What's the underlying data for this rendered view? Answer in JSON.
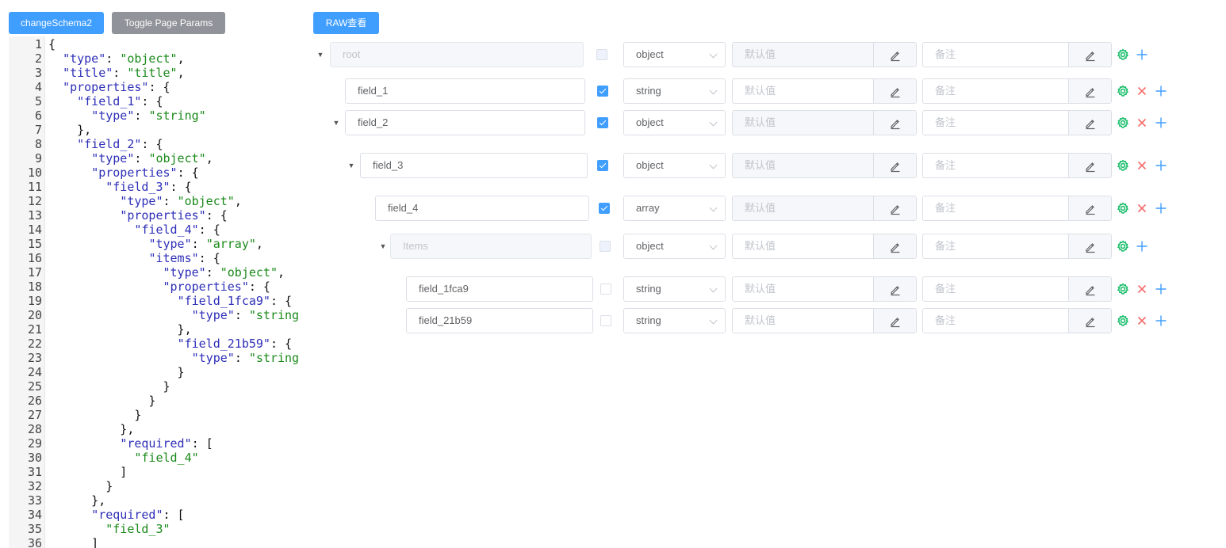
{
  "toolbar": {
    "change_schema_label": "changeSchema2",
    "toggle_params_label": "Toggle Page Params",
    "raw_view_label": "RAW查看"
  },
  "editor": {
    "lines": [
      {
        "n": "1",
        "t": "{"
      },
      {
        "n": "2",
        "t": "  \"type\": \"object\","
      },
      {
        "n": "3",
        "t": "  \"title\": \"title\","
      },
      {
        "n": "4",
        "t": "  \"properties\": {"
      },
      {
        "n": "5",
        "t": "    \"field_1\": {"
      },
      {
        "n": "6",
        "t": "      \"type\": \"string\""
      },
      {
        "n": "7",
        "t": "    },"
      },
      {
        "n": "8",
        "t": "    \"field_2\": {"
      },
      {
        "n": "9",
        "t": "      \"type\": \"object\","
      },
      {
        "n": "10",
        "t": "      \"properties\": {"
      },
      {
        "n": "11",
        "t": "        \"field_3\": {"
      },
      {
        "n": "12",
        "t": "          \"type\": \"object\","
      },
      {
        "n": "13",
        "t": "          \"properties\": {"
      },
      {
        "n": "14",
        "t": "            \"field_4\": {"
      },
      {
        "n": "15",
        "t": "              \"type\": \"array\","
      },
      {
        "n": "16",
        "t": "              \"items\": {"
      },
      {
        "n": "17",
        "t": "                \"type\": \"object\","
      },
      {
        "n": "18",
        "t": "                \"properties\": {"
      },
      {
        "n": "19",
        "t": "                  \"field_1fca9\": {"
      },
      {
        "n": "20",
        "t": "                    \"type\": \"string"
      },
      {
        "n": "21",
        "t": "                  },"
      },
      {
        "n": "22",
        "t": "                  \"field_21b59\": {"
      },
      {
        "n": "23",
        "t": "                    \"type\": \"string"
      },
      {
        "n": "24",
        "t": "                  }"
      },
      {
        "n": "25",
        "t": "                }"
      },
      {
        "n": "26",
        "t": "              }"
      },
      {
        "n": "27",
        "t": "            }"
      },
      {
        "n": "28",
        "t": "          },"
      },
      {
        "n": "29",
        "t": "          \"required\": ["
      },
      {
        "n": "30",
        "t": "            \"field_4\""
      },
      {
        "n": "31",
        "t": "          ]"
      },
      {
        "n": "32",
        "t": "        }"
      },
      {
        "n": "33",
        "t": "      },"
      },
      {
        "n": "34",
        "t": "      \"required\": ["
      },
      {
        "n": "35",
        "t": "        \"field_3\""
      },
      {
        "n": "36",
        "t": "      ]"
      }
    ]
  },
  "schema": {
    "default_placeholder": "默认值",
    "note_placeholder": "备注",
    "rows": [
      {
        "name": "root",
        "type": "object",
        "required": false,
        "expandable": true,
        "disabled": true,
        "removable": false,
        "default_disabled": true
      },
      {
        "name": "field_1",
        "type": "string",
        "required": true,
        "expandable": false,
        "disabled": false,
        "removable": true,
        "default_disabled": false
      },
      {
        "name": "field_2",
        "type": "object",
        "required": true,
        "expandable": true,
        "disabled": false,
        "removable": true,
        "default_disabled": true
      },
      {
        "name": "field_3",
        "type": "object",
        "required": true,
        "expandable": true,
        "disabled": false,
        "removable": true,
        "default_disabled": true
      },
      {
        "name": "field_4",
        "type": "array",
        "required": true,
        "expandable": false,
        "disabled": false,
        "removable": true,
        "default_disabled": true
      },
      {
        "name": "Items",
        "type": "object",
        "required": false,
        "expandable": true,
        "disabled": true,
        "removable": false,
        "default_disabled": false
      },
      {
        "name": "field_1fca9",
        "type": "string",
        "required": false,
        "expandable": false,
        "disabled": false,
        "removable": true,
        "default_disabled": false
      },
      {
        "name": "field_21b59",
        "type": "string",
        "required": false,
        "expandable": false,
        "disabled": false,
        "removable": true,
        "default_disabled": false
      }
    ]
  },
  "colors": {
    "primary": "#409eff",
    "secondary": "#909399",
    "settings_icon": "#19be6b",
    "delete_icon": "#f56c6c",
    "add_icon": "#409eff"
  },
  "icons": {
    "caret": "caret-down-icon",
    "edit": "edit-icon",
    "settings": "settings-icon",
    "delete": "close-icon",
    "add": "plus-icon"
  }
}
